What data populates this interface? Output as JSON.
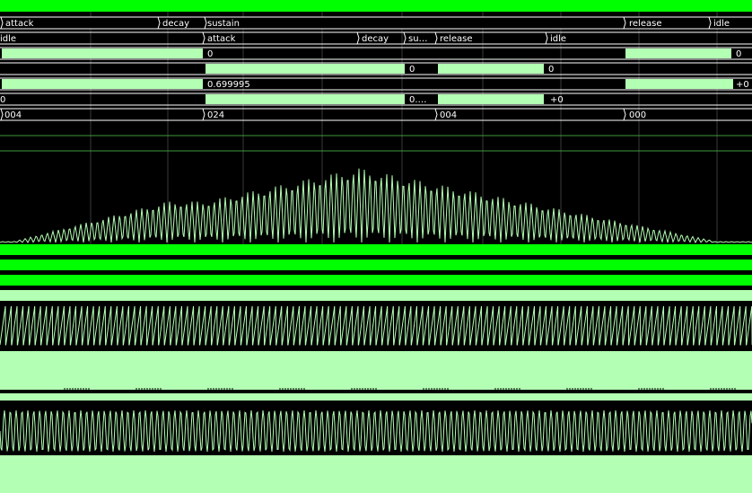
{
  "colors": {
    "background": "#000000",
    "bright_green": "#00ff00",
    "pale_green": "#b3ffb3",
    "text": "#ffffff",
    "grid": "#3a3a3a"
  },
  "signals": {
    "state_a": {
      "segments": [
        {
          "label": "attack"
        },
        {
          "label": "decay"
        },
        {
          "label": "sustain"
        },
        {
          "label": "release"
        },
        {
          "label": "idle"
        }
      ]
    },
    "state_b": {
      "segments": [
        {
          "label": "idle"
        },
        {
          "label": "attack"
        },
        {
          "label": "decay"
        },
        {
          "label": "su…"
        },
        {
          "label": "release"
        },
        {
          "label": "idle"
        }
      ]
    },
    "row_3": {
      "values": [
        "0",
        "0"
      ]
    },
    "row_4": {
      "values": [
        "0",
        "0"
      ]
    },
    "row_5": {
      "values": [
        "0.699995",
        "+0"
      ]
    },
    "row_6": {
      "values": [
        "0",
        "0.…",
        "+0"
      ]
    },
    "row_7": {
      "values": [
        "004",
        "024",
        "004",
        "000"
      ]
    }
  }
}
